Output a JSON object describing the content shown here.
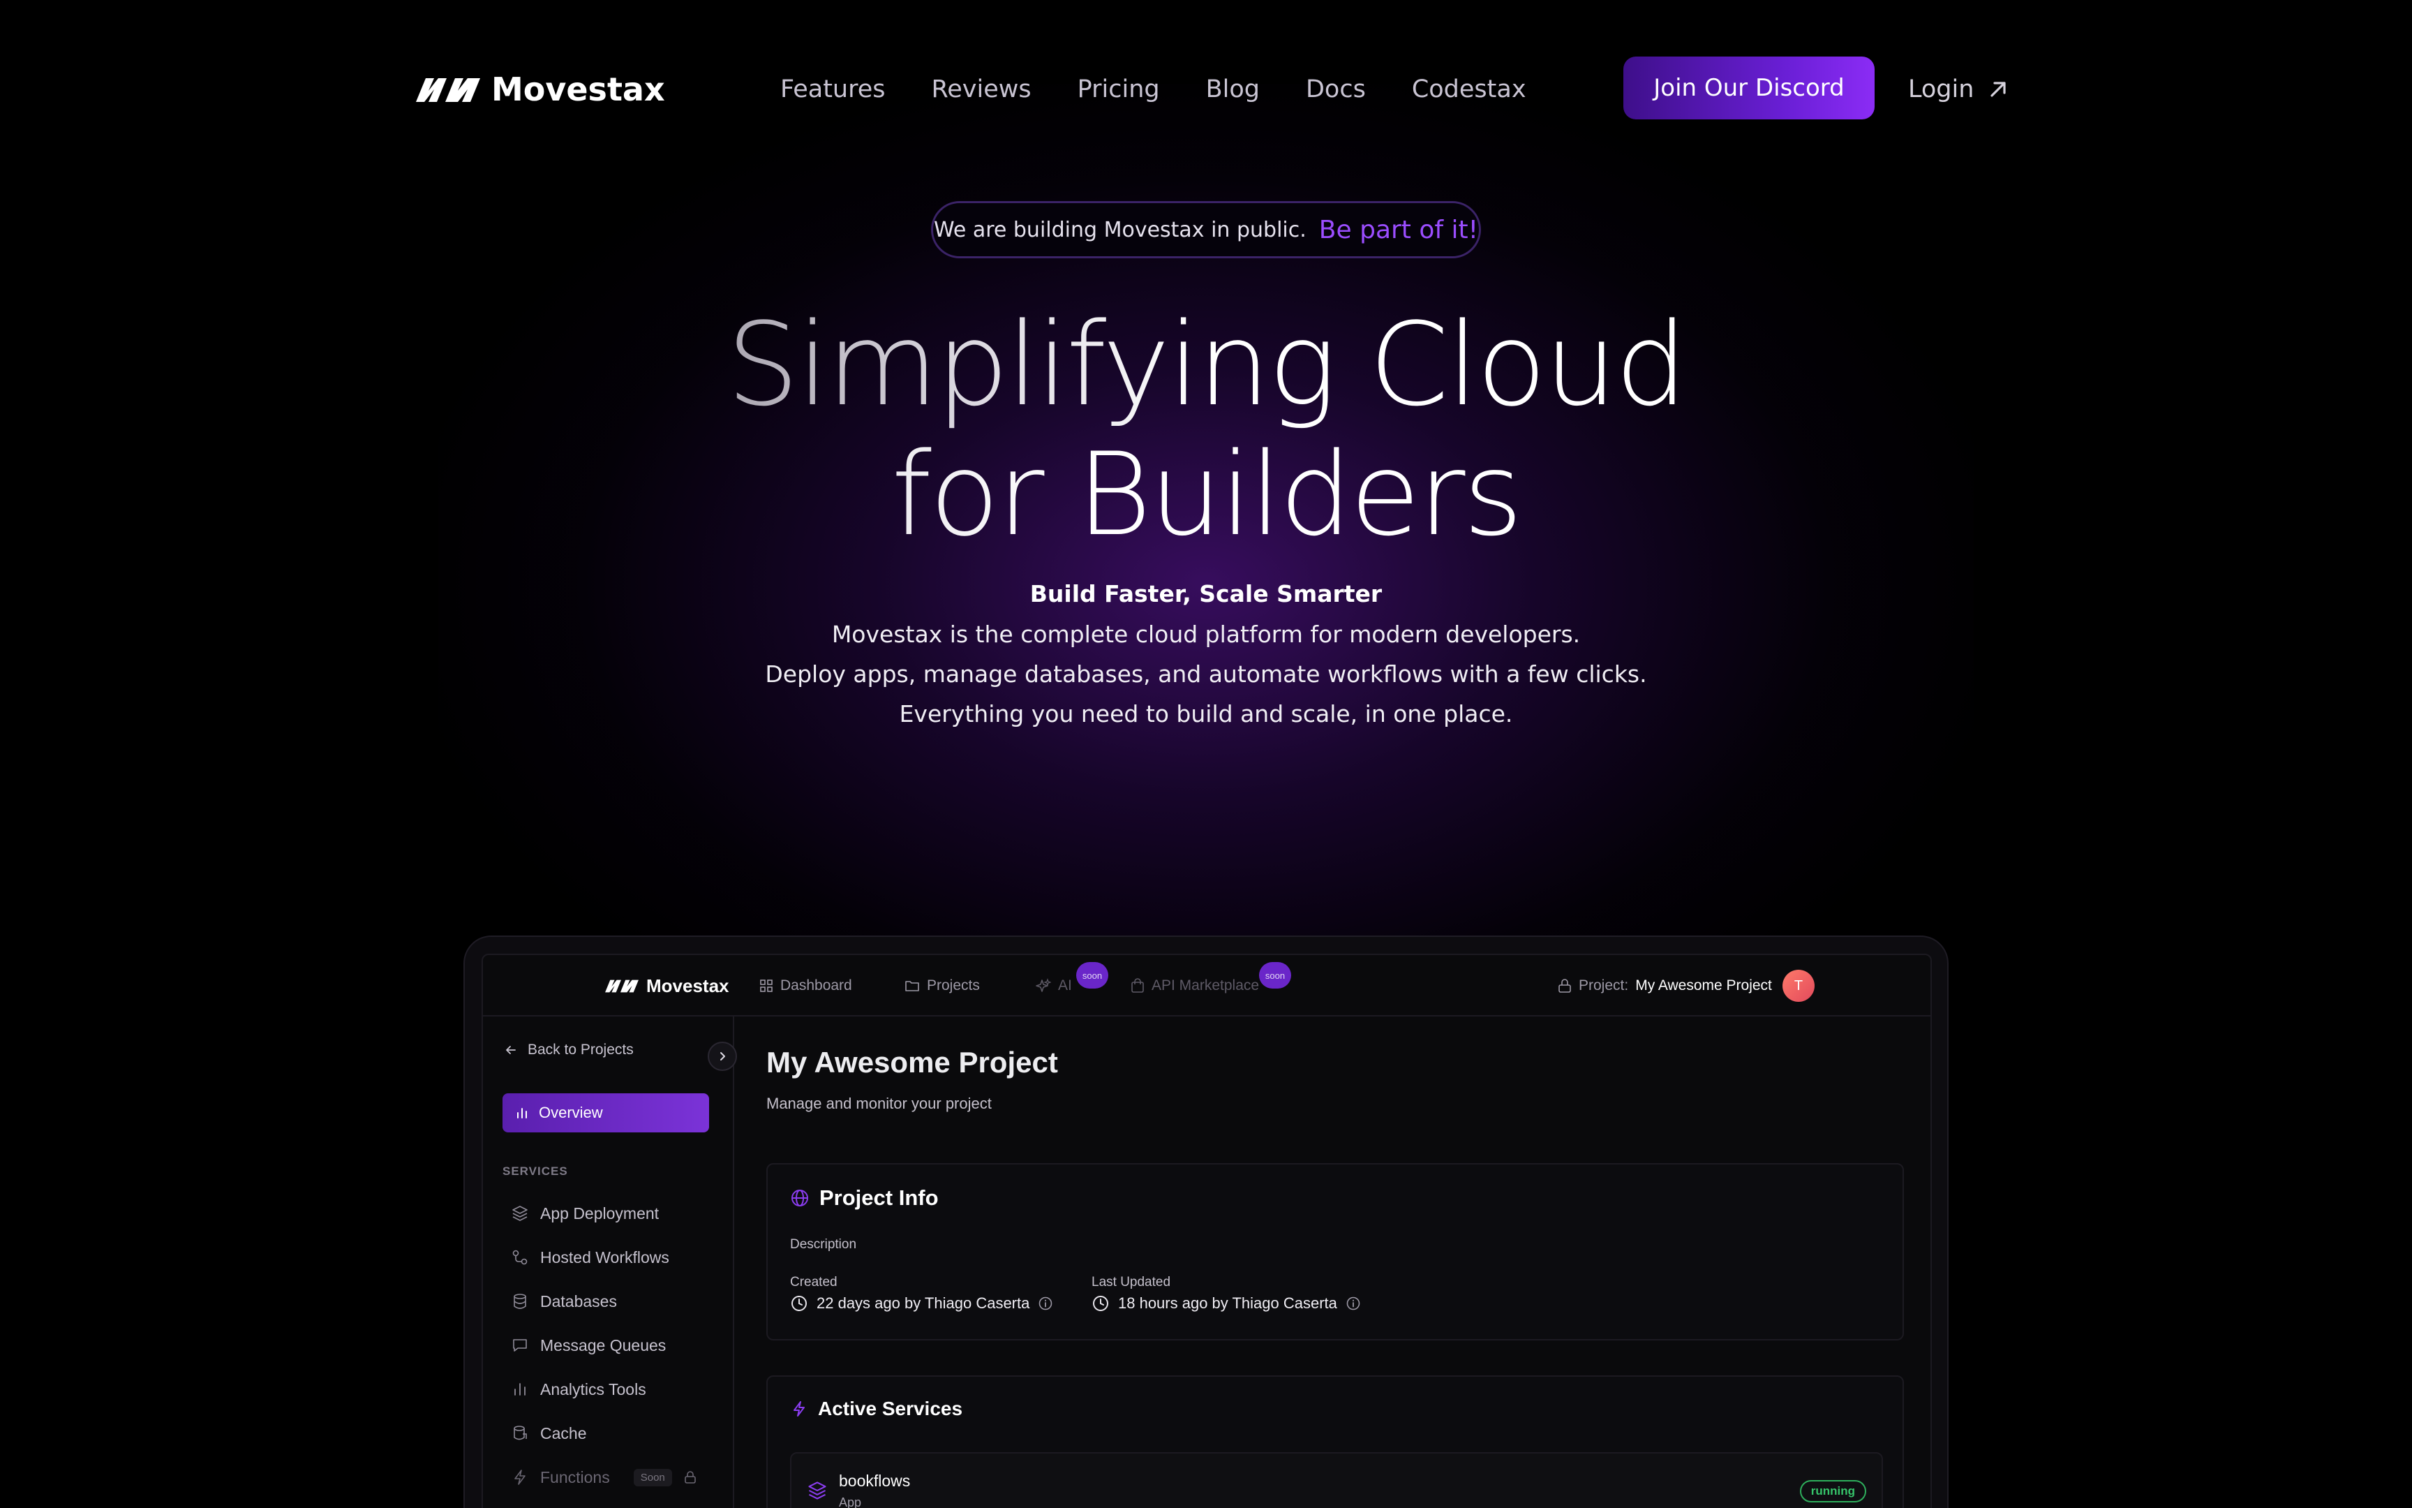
{
  "nav": {
    "brand": "Movestax",
    "links": [
      "Features",
      "Reviews",
      "Pricing",
      "Blog",
      "Docs",
      "Codestax"
    ],
    "discord_label": "Join Our Discord",
    "login_label": "Login"
  },
  "hero": {
    "pill_text": "We are building Movestax in public.",
    "pill_link": "Be part of it!",
    "title_line1": "Simplifying Cloud",
    "title_line2": "for Builders",
    "subtitle_bold": "Build Faster, Scale Smarter",
    "subtitle_lines": [
      "Movestax is the complete cloud platform for modern developers.",
      "Deploy apps, manage databases, and automate workflows with a few clicks.",
      "Everything you need to build and scale, in one place."
    ]
  },
  "app": {
    "brand": "Movestax",
    "topbar": {
      "dashboard": "Dashboard",
      "projects": "Projects",
      "ai": "AI",
      "ai_badge": "soon",
      "api_marketplace": "API Marketplace",
      "api_badge": "soon",
      "project_label": "Project:",
      "project_name": "My Awesome Project",
      "avatar_initial": "T"
    },
    "sidebar": {
      "back": "Back to Projects",
      "overview": "Overview",
      "services_label": "SERVICES",
      "items": [
        {
          "label": "App Deployment",
          "icon": "layers-icon"
        },
        {
          "label": "Hosted Workflows",
          "icon": "workflow-icon"
        },
        {
          "label": "Databases",
          "icon": "database-icon"
        },
        {
          "label": "Message Queues",
          "icon": "message-icon"
        },
        {
          "label": "Analytics Tools",
          "icon": "bar-chart-icon"
        },
        {
          "label": "Cache",
          "icon": "cache-icon"
        },
        {
          "label": "Functions",
          "icon": "bolt-icon",
          "tag": "Soon",
          "locked": true
        }
      ]
    },
    "main": {
      "title": "My Awesome Project",
      "subtitle": "Manage and monitor your project",
      "project_info": {
        "title": "Project Info",
        "description_label": "Description",
        "created_label": "Created",
        "created_value": "22 days ago by Thiago Caserta",
        "updated_label": "Last Updated",
        "updated_value": "18 hours ago by Thiago Caserta"
      },
      "active_services": {
        "title": "Active Services",
        "services": [
          {
            "name": "bookflows",
            "type": "App",
            "status": "running"
          }
        ]
      }
    }
  },
  "colors": {
    "accent": "#7b33d8",
    "pill_link": "#9b4dff",
    "running": "#36c46a",
    "background": "#000000"
  }
}
